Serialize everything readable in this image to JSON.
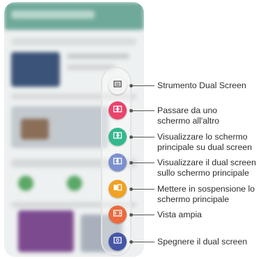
{
  "tools": [
    {
      "icon": "screen-tool-icon",
      "color": "#f4f4f4",
      "label": "Strumento Dual Screen"
    },
    {
      "icon": "swap-screens-icon",
      "color": "#e9436c",
      "label": "Passare da uno\nschermo all'altro"
    },
    {
      "icon": "show-main-on-dual-icon",
      "color": "#33b88e",
      "label": "Visualizzare lo schermo\nprincipale su dual screen"
    },
    {
      "icon": "show-dual-on-main-icon",
      "color": "#7b91cf",
      "label": "Visualizzare il dual screen\nsullo schermo principale"
    },
    {
      "icon": "pause-main-screen-icon",
      "color": "#f0a223",
      "label": "Mettere in sospensione lo\nschermo principale"
    },
    {
      "icon": "wide-view-icon",
      "color": "#ec6a3f",
      "label": "Vista ampia"
    },
    {
      "icon": "dual-screen-off-icon",
      "color": "#4656a6",
      "label": "Spegnere il dual screen"
    }
  ]
}
